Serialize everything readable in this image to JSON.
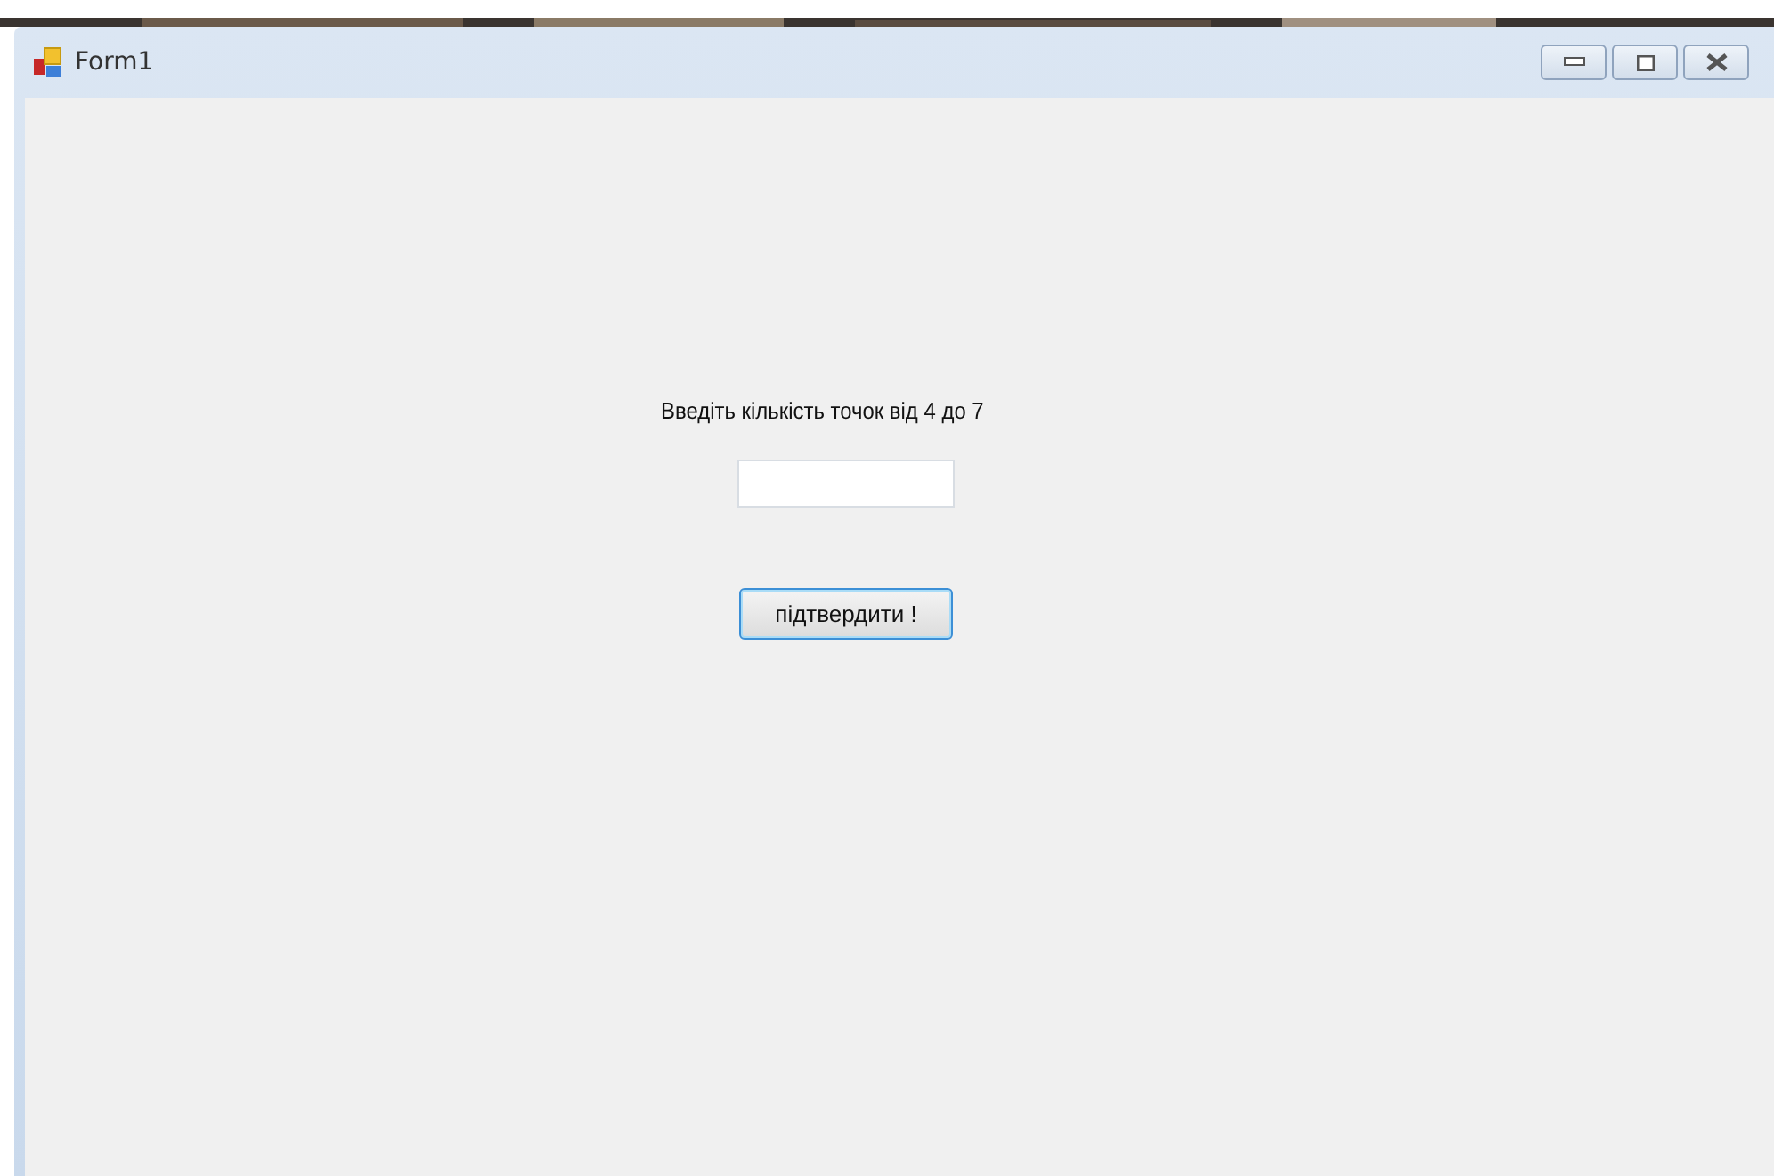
{
  "window": {
    "title": "Form1"
  },
  "form": {
    "prompt": "Введіть кількість точок від 4 до 7",
    "button": "підтвердити !"
  }
}
